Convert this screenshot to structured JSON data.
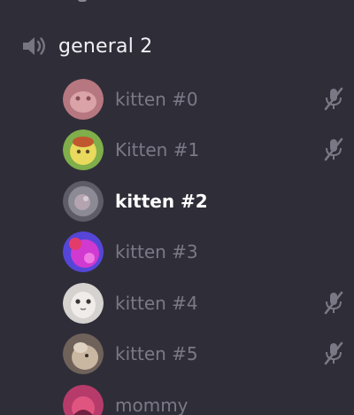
{
  "channel": {
    "name": "general 2",
    "icon": "speaker-icon"
  },
  "members": [
    {
      "name": "kitten #0",
      "muted": true,
      "active": false,
      "avatar_color": "#c98a92"
    },
    {
      "name": "Kitten #1",
      "muted": true,
      "active": false,
      "avatar_color": "#d9c94a"
    },
    {
      "name": "kitten #2",
      "muted": false,
      "active": true,
      "avatar_color": "#7e7c86"
    },
    {
      "name": "kitten #3",
      "muted": false,
      "active": false,
      "avatar_color": "#c23ad6"
    },
    {
      "name": "kitten #4",
      "muted": true,
      "active": false,
      "avatar_color": "#e6e3e1"
    },
    {
      "name": "kitten #5",
      "muted": true,
      "active": false,
      "avatar_color": "#a89684"
    },
    {
      "name": "mommy",
      "muted": false,
      "active": false,
      "avatar_color": "#d14a86"
    }
  ],
  "colors": {
    "background": "#2f2e38",
    "channel_text": "#f1f0f5",
    "member_text": "#7b7986",
    "active_text": "#ffffff",
    "icon": "#77757f"
  }
}
